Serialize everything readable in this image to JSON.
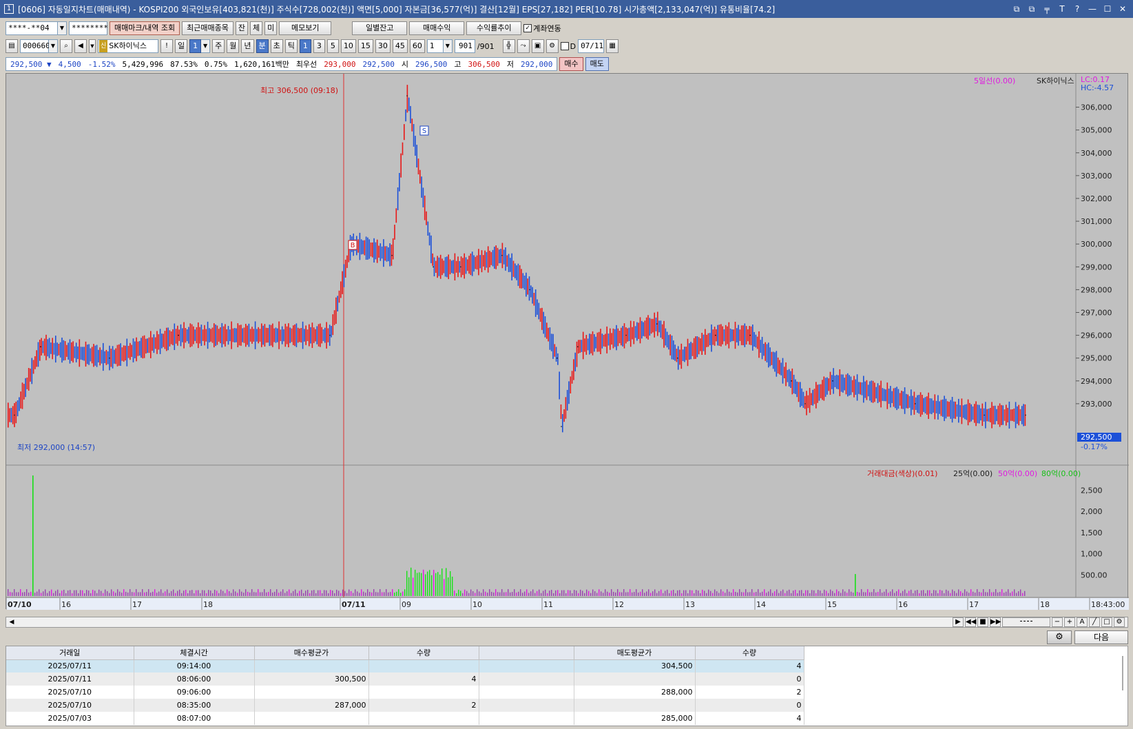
{
  "window": {
    "icon": "1",
    "title": "[0606] 자동일지차트(매매내역) - KOSPI200 외국인보유[403,821(천)] 주식수[728,002(천)] 액면[5,000] 자본금[36,577(억)] 결산[12월] EPS[27,182] PER[10.78] 시가총액[2,133,047(억)] 유통비율[74.2]",
    "buttons": [
      "⧉",
      "⧉",
      "╤",
      "T",
      "?",
      "—",
      "☐",
      "✕"
    ]
  },
  "row1": {
    "account": "****-**04",
    "password": "********",
    "btn_trade_mark": "매매마크/내역 조회",
    "btn_recent": "최근매매종목",
    "btn_jan": "잔",
    "btn_che": "체",
    "btn_mi": "미",
    "btn_memo": "메모보기",
    "btn_daily": "일별잔고",
    "btn_profit": "매매수익",
    "btn_rate": "수익률추이",
    "link_account_label": "계좌연동",
    "link_account_checked": "✓"
  },
  "row2": {
    "code": "000660",
    "stock_name": "SK하이닉스",
    "tag": "신",
    "alert": "!",
    "period_label": "일",
    "period_value": "1",
    "periods": [
      "주",
      "월",
      "년",
      "분",
      "초",
      "틱"
    ],
    "intervals": [
      "1",
      "3",
      "5",
      "10",
      "15",
      "30",
      "45",
      "60"
    ],
    "count": "1",
    "bars_shown": "901",
    "bars_total": "/901",
    "d_label": "D",
    "date": "07/11"
  },
  "quote": {
    "price": "292,500",
    "arrow": "▼",
    "change": "4,500",
    "change_pct": "-1.52%",
    "volume": "5,429,996",
    "vol_ratio": "87.53%",
    "turnover_pct": "0.75%",
    "amount": "1,620,161백만",
    "best_label": "최우선",
    "ask": "293,000",
    "bid": "292,500",
    "open_label": "시",
    "open": "296,500",
    "high_label": "고",
    "high": "306,500",
    "low_label": "저",
    "low": "292,000",
    "buy_btn": "매수",
    "sell_btn": "매도"
  },
  "chart_data": [
    {
      "type": "line",
      "legend": [
        "5일선(0.00)",
        "SK하이닉스"
      ],
      "lc": "LC:0.17",
      "hc": "HC:-4.57",
      "annotation_high": "최고 306,500 (09:18)",
      "annotation_low": "최저 292,000 (14:57)",
      "markers": [
        "B",
        "S"
      ],
      "current_price": "292,500",
      "current_pct": "-0.17%",
      "ylim": [
        292000,
        306500
      ],
      "yticks": [
        "306,000",
        "305,000",
        "304,000",
        "303,000",
        "302,000",
        "301,000",
        "300,000",
        "299,000",
        "298,000",
        "297,000",
        "296,000",
        "295,000",
        "294,000",
        "293,000"
      ],
      "x": [
        "07/10 15:00",
        "07/10 16:00",
        "07/10 17:00",
        "07/10 18:00",
        "07/11 08:00",
        "07/11 08:30",
        "07/11 09:00",
        "07/11 09:18",
        "07/11 09:40",
        "07/11 10:00",
        "07/11 10:30",
        "07/11 11:00",
        "07/11 11:30",
        "07/11 11:50",
        "07/11 12:00",
        "07/11 12:30",
        "07/11 13:00",
        "07/11 13:30",
        "07/11 14:00",
        "07/11 14:30",
        "07/11 15:00",
        "07/11 15:30",
        "07/11 16:00",
        "07/11 17:00",
        "07/11 18:00",
        "07/11 18:43"
      ],
      "values": [
        292500,
        295500,
        295000,
        296000,
        296000,
        300000,
        299500,
        306500,
        299000,
        299000,
        299500,
        298000,
        295000,
        292000,
        295500,
        296000,
        296500,
        295000,
        296000,
        296000,
        294000,
        293000,
        294000,
        293000,
        292500,
        292500
      ]
    },
    {
      "type": "bar",
      "legend": [
        "거래대금(색상)(0.01)",
        "25억(0.00)",
        "50억(0.00)",
        "80억(0.00)"
      ],
      "ylim": [
        0,
        2900
      ],
      "yticks": [
        "2,500",
        "2,000",
        "1,500",
        "1,000",
        "500.00"
      ],
      "x_ticks": [
        "07/10",
        "16",
        "17",
        "18",
        "07/11",
        "09",
        "10",
        "11",
        "12",
        "13",
        "14",
        "15",
        "16",
        "17",
        "18",
        "18:43:00"
      ],
      "spikes": [
        {
          "x": "07/10 15:00",
          "value": 2850
        },
        {
          "x": "07/11 15:30",
          "value": 520
        }
      ]
    }
  ],
  "table": {
    "btn_next": "다음",
    "headers": [
      "거래일",
      "체결시간",
      "매수평균가",
      "수량",
      "",
      "매도평균가",
      "수량"
    ],
    "rows": [
      [
        "2025/07/11",
        "09:14:00",
        "",
        "",
        "",
        "304,500",
        "4"
      ],
      [
        "2025/07/11",
        "08:06:00",
        "300,500",
        "4",
        "",
        "",
        "0"
      ],
      [
        "2025/07/10",
        "09:06:00",
        "",
        "",
        "",
        "288,000",
        "2"
      ],
      [
        "2025/07/10",
        "08:35:00",
        "287,000",
        "2",
        "",
        "",
        "0"
      ],
      [
        "2025/07/03",
        "08:07:00",
        "",
        "",
        "",
        "285,000",
        "4"
      ]
    ]
  },
  "colors": {
    "up": "#e81818",
    "down": "#1c50d8",
    "chart_bg": "#c0c0c0",
    "vol_green": "#18e018",
    "vol_magenta": "#e018e0",
    "title_bg": "#3a5e9c"
  }
}
